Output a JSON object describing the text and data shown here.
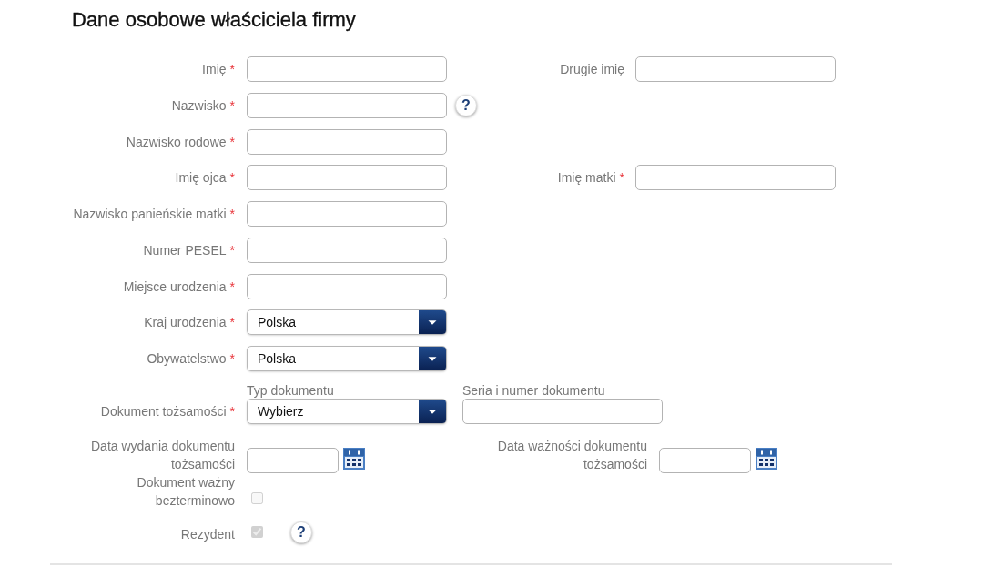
{
  "title": "Dane osobowe właściciela firmy",
  "required_mark": "*",
  "rows": [
    {
      "kind": "input",
      "label": "Imię",
      "required": true,
      "side": {
        "label": "Drugie imię",
        "required": false
      }
    },
    {
      "kind": "input",
      "label": "Nazwisko",
      "required": true,
      "help": "?"
    },
    {
      "kind": "input",
      "label": "Nazwisko rodowe",
      "required": true
    },
    {
      "kind": "input",
      "label": "Imię ojca",
      "required": true,
      "side": {
        "label": "Imię matki",
        "required": true
      }
    },
    {
      "kind": "input",
      "label": "Nazwisko panieńskie matki",
      "required": true
    },
    {
      "kind": "input",
      "label": "Numer PESEL",
      "required": true
    },
    {
      "kind": "input",
      "label": "Miejsce urodzenia",
      "required": true
    },
    {
      "kind": "select",
      "label": "Kraj urodzenia",
      "required": true,
      "value": "Polska"
    },
    {
      "kind": "select",
      "label": "Obywatelstwo",
      "required": true,
      "value": "Polska"
    },
    {
      "kind": "document",
      "label": "Dokument tożsamości",
      "required": true,
      "type_caption": "Typ dokumentu",
      "type_value": "Wybierz",
      "number_caption": "Seria i numer dokumentu"
    },
    {
      "kind": "date",
      "label": "Data wydania dokumentu tożsamości",
      "required": false,
      "side": {
        "label": "Data ważności dokumentu tożsamości",
        "required": false
      }
    },
    {
      "kind": "checkbox",
      "label": "Dokument ważny bezterminowo",
      "required": false,
      "checked": false,
      "disabled": true
    },
    {
      "kind": "checkbox",
      "label": "Rezydent",
      "required": false,
      "checked": true,
      "disabled": true,
      "help": "?"
    }
  ]
}
